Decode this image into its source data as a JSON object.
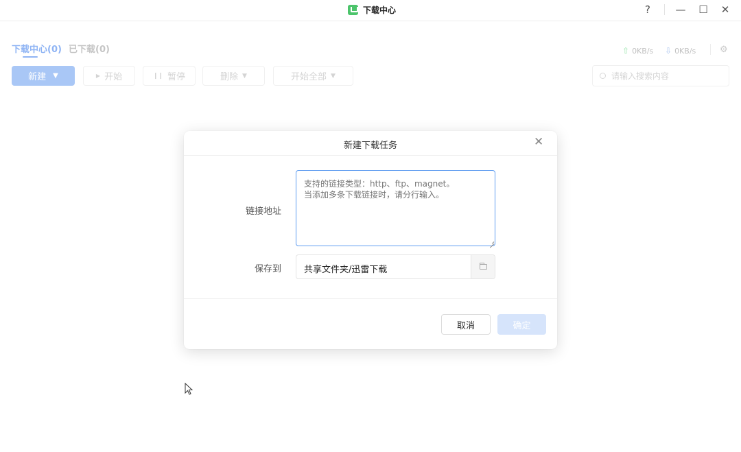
{
  "window": {
    "title": "下载中心",
    "help_glyph": "?",
    "minimize_glyph": "—",
    "maximize_glyph": "☐",
    "close_glyph": "✕"
  },
  "tabs": [
    {
      "label": "下载中心(0)",
      "active": true
    },
    {
      "label": "已下载(0)",
      "active": false
    }
  ],
  "speed": {
    "upload": "0KB/s",
    "download": "0KB/s"
  },
  "toolbar": {
    "new_label": "新建",
    "start_label": "开始",
    "pause_label": "暂停",
    "delete_label": "删除",
    "start_all_label": "开始全部",
    "search_placeholder": "请输入搜索内容"
  },
  "dialog": {
    "title": "新建下载任务",
    "url_label": "链接地址",
    "url_placeholder": "支持的链接类型：http、ftp、magnet。\n当添加多条下载链接时，请分行输入。",
    "save_label": "保存到",
    "save_path": "共享文件夹/迅雷下载",
    "cancel_label": "取消",
    "ok_label": "确定"
  },
  "colors": {
    "accent": "#a9c7f6",
    "tab_active": "#8fb4f4",
    "focus_border": "#5c9bf0",
    "app_icon": "#4cc46b"
  },
  "icons": [
    "app-icon",
    "help-icon",
    "minimize-icon",
    "maximize-icon",
    "close-icon",
    "upload-icon",
    "download-icon",
    "settings-icon",
    "chevron-down-icon",
    "play-icon",
    "pause-icon",
    "search-icon",
    "folder-icon",
    "cursor-icon"
  ]
}
